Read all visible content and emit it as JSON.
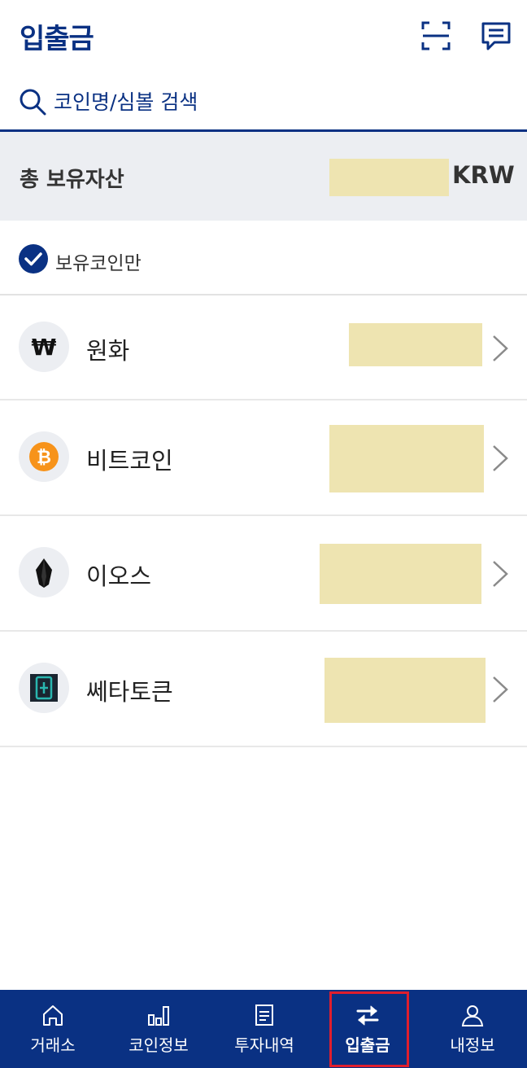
{
  "header": {
    "title": "입출금",
    "icons": [
      "scan-icon",
      "chat-icon"
    ]
  },
  "search": {
    "placeholder": "코인명/심볼 검색",
    "value": ""
  },
  "total": {
    "label": "총 보유자산",
    "unit": "KRW"
  },
  "filter": {
    "label": "보유코인만",
    "checked": true
  },
  "coins": [
    {
      "name": "원화",
      "icon": "won-icon"
    },
    {
      "name": "비트코인",
      "icon": "bitcoin-icon"
    },
    {
      "name": "이오스",
      "icon": "eos-icon"
    },
    {
      "name": "쎄타토큰",
      "icon": "theta-icon"
    }
  ],
  "nav": [
    {
      "label": "거래소",
      "icon": "home-icon"
    },
    {
      "label": "코인정보",
      "icon": "bar-chart-icon"
    },
    {
      "label": "투자내역",
      "icon": "document-icon"
    },
    {
      "label": "입출금",
      "icon": "transfer-icon",
      "active": true
    },
    {
      "label": "내정보",
      "icon": "user-icon"
    }
  ],
  "colors": {
    "brand": "#0a3183",
    "highlight": "#e01e2d",
    "mask": "#eee4b1",
    "bitcoin": "#f7931a",
    "theta": "#29b6af"
  }
}
